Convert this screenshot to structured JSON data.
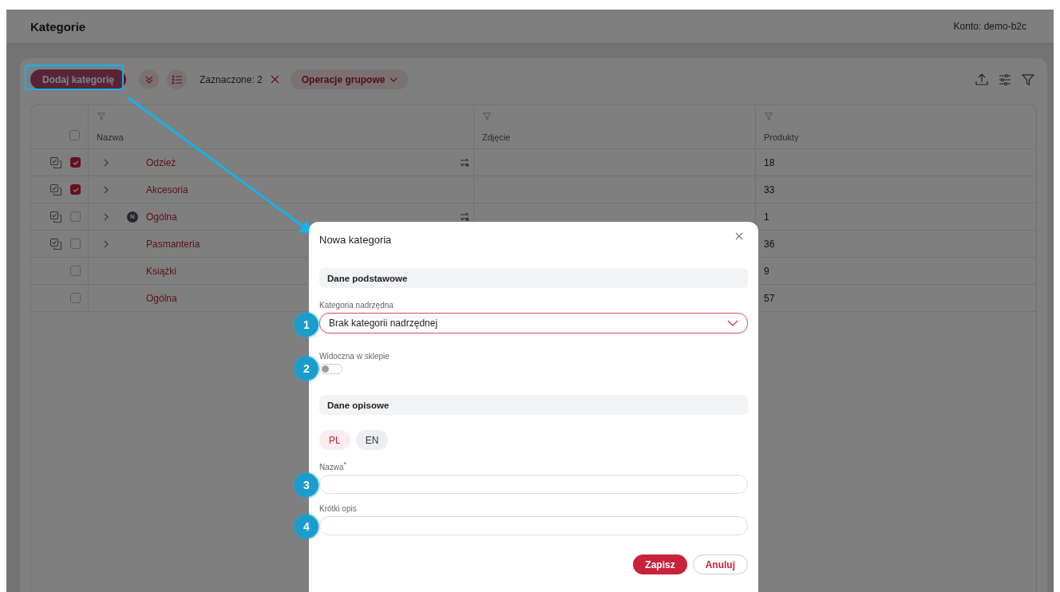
{
  "header": {
    "title": "Kategorie",
    "account": "Konto: demo-b2c"
  },
  "toolbar": {
    "add_button": "Dodaj kategorię",
    "selected_count": "Zaznaczone: 2",
    "bulk_menu": "Operacje grupowe"
  },
  "table": {
    "select_all": false,
    "columns": [
      {
        "label": "Nazwa"
      },
      {
        "label": "Zdjęcie"
      },
      {
        "label": "Produkty"
      }
    ],
    "rows": [
      {
        "name": "Odzież",
        "products": "18",
        "checked": true,
        "has_children": true,
        "linked": true
      },
      {
        "name": "Akcesoria",
        "products": "33",
        "checked": true,
        "has_children": true,
        "linked": false
      },
      {
        "name": "Ogólna",
        "products": "1",
        "checked": false,
        "has_children": true,
        "linked": true,
        "badge": "N"
      },
      {
        "name": "Pasmanteria",
        "products": "36",
        "checked": false,
        "has_children": true,
        "linked": false
      },
      {
        "name": "Książki",
        "products": "9",
        "checked": false,
        "has_children": false,
        "linked": false
      },
      {
        "name": "Ogólna",
        "products": "57",
        "checked": false,
        "has_children": false,
        "linked": false
      }
    ]
  },
  "dialog": {
    "title": "Nowa kategoria",
    "items": [
      {
        "kind": "section",
        "label": "Dane podstawowe"
      },
      {
        "kind": "select",
        "label": "Kategoria nadrzędna",
        "value": "Brak kategorii nadrzędnej",
        "marker": "1"
      },
      {
        "kind": "toggle",
        "label": "Widoczna w sklepie",
        "on": false,
        "marker": "2"
      },
      {
        "kind": "section",
        "label": "Dane opisowe"
      },
      {
        "kind": "languages",
        "options": [
          {
            "label": "PL",
            "selected": true
          },
          {
            "label": "EN",
            "selected": false
          }
        ]
      },
      {
        "kind": "text",
        "label": "Nazwa$^{*}$",
        "marker": "3"
      },
      {
        "kind": "text",
        "label": "Krótki opis",
        "marker": "4"
      }
    ],
    "save": "Zapisz",
    "cancel": "Anuluj"
  }
}
